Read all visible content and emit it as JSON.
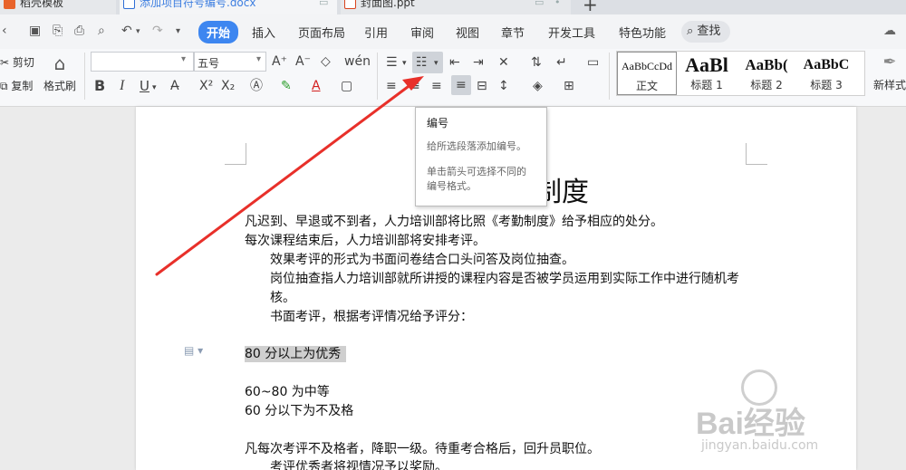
{
  "tabs": [
    {
      "label": "稻壳模板"
    },
    {
      "label": "添加项目符号编号.docx"
    },
    {
      "label": "封面图.ppt"
    }
  ],
  "menu": {
    "items": [
      "开始",
      "插入",
      "页面布局",
      "引用",
      "审阅",
      "视图",
      "章节",
      "开发工具",
      "特色功能"
    ],
    "search": "查找"
  },
  "ribbon": {
    "cut": "剪切",
    "copy": "复制",
    "format_painter": "格式刷",
    "font_size": "五号",
    "bold": "B",
    "italic": "I",
    "underline": "U",
    "superscript": "X²",
    "subscript": "X₂",
    "font_color_letter": "A",
    "styles": [
      {
        "preview": "AaBbCcDd",
        "name": "正文"
      },
      {
        "preview": "AaBl",
        "name": "标题 1"
      },
      {
        "preview": "AaBb(",
        "name": "标题 2"
      },
      {
        "preview": "AaBbC",
        "name": "标题 3"
      }
    ],
    "new_style": "新样式"
  },
  "tooltip": {
    "title": "编号",
    "line1": "给所选段落添加编号。",
    "line2": "单击箭头可选择不同的",
    "line3": "编号格式。"
  },
  "document": {
    "title": "制度",
    "paragraphs": [
      "凡迟到、早退或不到者，人力培训部将比照《考勤制度》给予相应的处分。",
      "每次课程结束后，人力培训部将安排考评。",
      "效果考评的形式为书面问卷结合口头问答及岗位抽查。",
      "岗位抽查指人力培训部就所讲授的课程内容是否被学员运用到实际工作中进行随机考",
      "核。",
      "书面考评，根据考评情况给予评分：",
      "80 分以上为优秀",
      "60~80 为中等",
      "60 分以下为不及格",
      "凡每次考评不及格者，降职一级。待重考合格后，回升员职位。",
      "考评优秀者将视情况予以奖励。"
    ]
  },
  "watermark": {
    "logo": "Bai经验",
    "url": "jingyan.baidu.com"
  },
  "colors": {
    "accent": "#3d86f0",
    "arrow": "#e8302a",
    "highlight": "#cfcfcf"
  }
}
